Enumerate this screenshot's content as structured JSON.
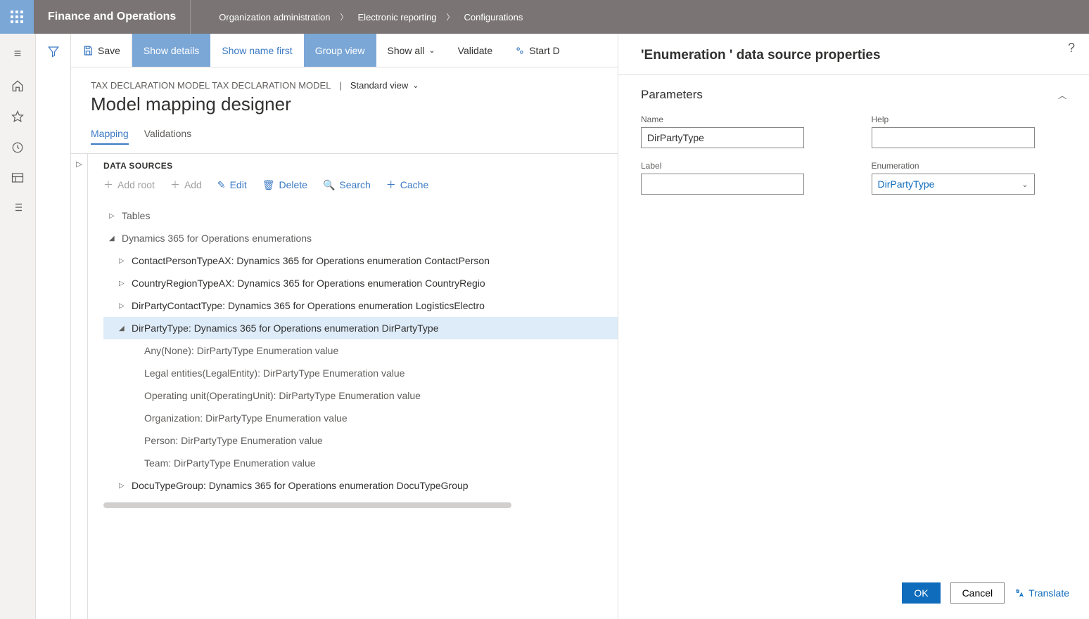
{
  "header": {
    "app_title": "Finance and Operations",
    "breadcrumb": [
      "Organization administration",
      "Electronic reporting",
      "Configurations"
    ]
  },
  "toolbar": {
    "save": "Save",
    "show_details": "Show details",
    "show_name_first": "Show name first",
    "group_view": "Group view",
    "show_all": "Show all",
    "validate": "Validate",
    "start_d": "Start D"
  },
  "page": {
    "model_path": "TAX DECLARATION MODEL TAX DECLARATION MODEL",
    "view_name": "Standard view",
    "title": "Model mapping designer",
    "tabs": {
      "mapping": "Mapping",
      "validations": "Validations"
    }
  },
  "ds": {
    "title": "DATA SOURCES",
    "tb": {
      "add_root": "Add root",
      "add": "Add",
      "edit": "Edit",
      "delete": "Delete",
      "search": "Search",
      "cache": "Cache"
    },
    "tree": {
      "tables": "Tables",
      "enums_root": "Dynamics 365 for Operations enumerations",
      "items": [
        "ContactPersonTypeAX: Dynamics 365 for Operations enumeration ContactPerson",
        "CountryRegionTypeAX: Dynamics 365 for Operations enumeration CountryRegio",
        "DirPartyContactType: Dynamics 365 for Operations enumeration LogisticsElectro"
      ],
      "selected": "DirPartyType: Dynamics 365 for Operations enumeration DirPartyType",
      "sel_children": [
        "Any(None): DirPartyType Enumeration value",
        "Legal entities(LegalEntity): DirPartyType Enumeration value",
        "Operating unit(OperatingUnit): DirPartyType Enumeration value",
        "Organization: DirPartyType Enumeration value",
        "Person: DirPartyType Enumeration value",
        "Team: DirPartyType Enumeration value"
      ],
      "last": "DocuTypeGroup: Dynamics 365 for Operations enumeration DocuTypeGroup"
    }
  },
  "panel": {
    "title": "'Enumeration ' data source properties",
    "section": "Parameters",
    "fields": {
      "name_label": "Name",
      "name_value": "DirPartyType",
      "help_label": "Help",
      "help_value": "",
      "label_label": "Label",
      "label_value": "",
      "enum_label": "Enumeration",
      "enum_value": "DirPartyType"
    },
    "ok": "OK",
    "cancel": "Cancel",
    "translate": "Translate"
  }
}
